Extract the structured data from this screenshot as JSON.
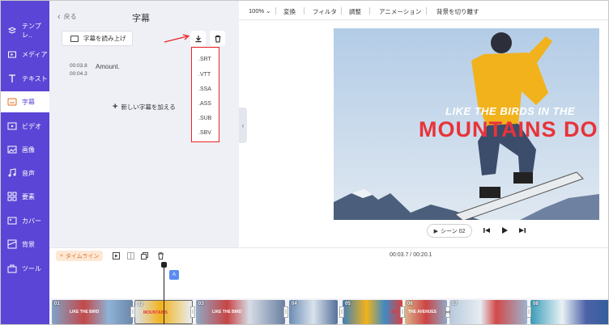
{
  "sidebar": {
    "items": [
      {
        "label": "テンプレ..",
        "icon": "template-icon"
      },
      {
        "label": "メディア",
        "icon": "media-folder-icon"
      },
      {
        "label": "テキスト",
        "icon": "text-icon"
      },
      {
        "label": "字幕",
        "icon": "subtitle-icon",
        "active": true
      },
      {
        "label": "ビデオ",
        "icon": "video-icon"
      },
      {
        "label": "画像",
        "icon": "image-icon"
      },
      {
        "label": "音声",
        "icon": "music-icon"
      },
      {
        "label": "要素",
        "icon": "elements-icon"
      },
      {
        "label": "カバー",
        "icon": "cover-icon"
      },
      {
        "label": "背景",
        "icon": "background-icon"
      },
      {
        "label": "ツール",
        "icon": "toolbox-icon"
      }
    ]
  },
  "panel": {
    "back_label": "戻る",
    "title": "字幕",
    "read_button": "字幕を読み上げ",
    "subtitle": {
      "start": "00:03.8",
      "end": "00:04.3",
      "text": "Amount."
    },
    "add_label": "新しい字幕を加える"
  },
  "download_menu": {
    "options": [
      ".SRT",
      ".VTT",
      ".SSA",
      ".ASS",
      ".SUB",
      ".SBV"
    ]
  },
  "toolbar": {
    "zoom": "100%",
    "items": [
      "変換",
      "フィルタ",
      "調整",
      "アニメーション",
      "背景を切り離す"
    ]
  },
  "video": {
    "caption_line1": "LIKE THE BIRDS IN THE",
    "caption_line2": "MOUNTAINS DO"
  },
  "playback": {
    "scene_label": "シーン 02"
  },
  "timeline": {
    "label": "タイムライン",
    "time": "00:03.7 / 00:20.1",
    "subtitle_marker": "A",
    "clips": [
      {
        "num": "01",
        "caption": "LIKE THE BIRD"
      },
      {
        "num": "02",
        "caption": "MOUNTAINS"
      },
      {
        "num": "03",
        "caption": "LIKE THE BIRD"
      },
      {
        "num": "04",
        "caption": ""
      },
      {
        "num": "05",
        "caption": "SO"
      },
      {
        "num": "06",
        "caption": "THE AVENUES"
      },
      {
        "num": "07",
        "caption": ""
      },
      {
        "num": "08",
        "caption": ""
      }
    ]
  },
  "colors": {
    "sidebar": "#5b45d6",
    "accent_red": "#e22222",
    "timeline_label_bg": "#fde8d6",
    "timeline_label_text": "#e06b1c",
    "jacket": "#f2b21c"
  }
}
